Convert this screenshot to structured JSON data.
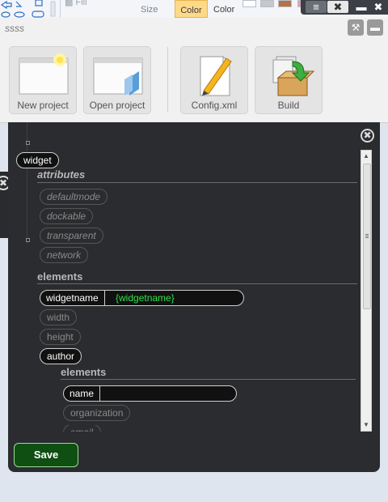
{
  "ribbon": {
    "fill_label": "Fill",
    "size_label": "Size",
    "color1_label": "Color",
    "color2_label": "Color",
    "swatches": [
      "#ffffff",
      "#c8c8c8",
      "#c7c7c7",
      "#b5714a",
      "#ffffff",
      "#e0a0b0"
    ]
  },
  "window_controls": {
    "min_icon": "menu-icon",
    "close1_icon": "close-icon",
    "min2_icon": "minimize-icon",
    "close2_icon": "close-icon"
  },
  "toolbar": {
    "title": "ssss",
    "tools": [
      {
        "label": "New project",
        "icon": "new-project-icon"
      },
      {
        "label": "Open project",
        "icon": "open-project-icon"
      },
      {
        "label": "Config.xml",
        "icon": "config-edit-icon"
      },
      {
        "label": "Build",
        "icon": "build-icon"
      }
    ],
    "settings_icon": "wrench-icon",
    "minimize_icon": "minimize-icon"
  },
  "editor": {
    "root_tag": "widget",
    "attributes_heading": "attributes",
    "attributes": [
      "defaultmode",
      "dockable",
      "transparent",
      "network"
    ],
    "elements_heading": "elements",
    "widgetname_label": "widgetname",
    "widgetname_value": "{widgetname}",
    "optional_elements": [
      "width",
      "height"
    ],
    "author_tag": "author",
    "author_elements_heading": "elements",
    "name_label": "name",
    "name_value": "",
    "author_optional": [
      "organization",
      "email"
    ],
    "save_label": "Save"
  },
  "colors": {
    "panel_bg": "#2b2c2f",
    "field_value": "#2fe04a",
    "save_bg": "#0f4f12",
    "active_color_tab": "#ffd98a"
  }
}
